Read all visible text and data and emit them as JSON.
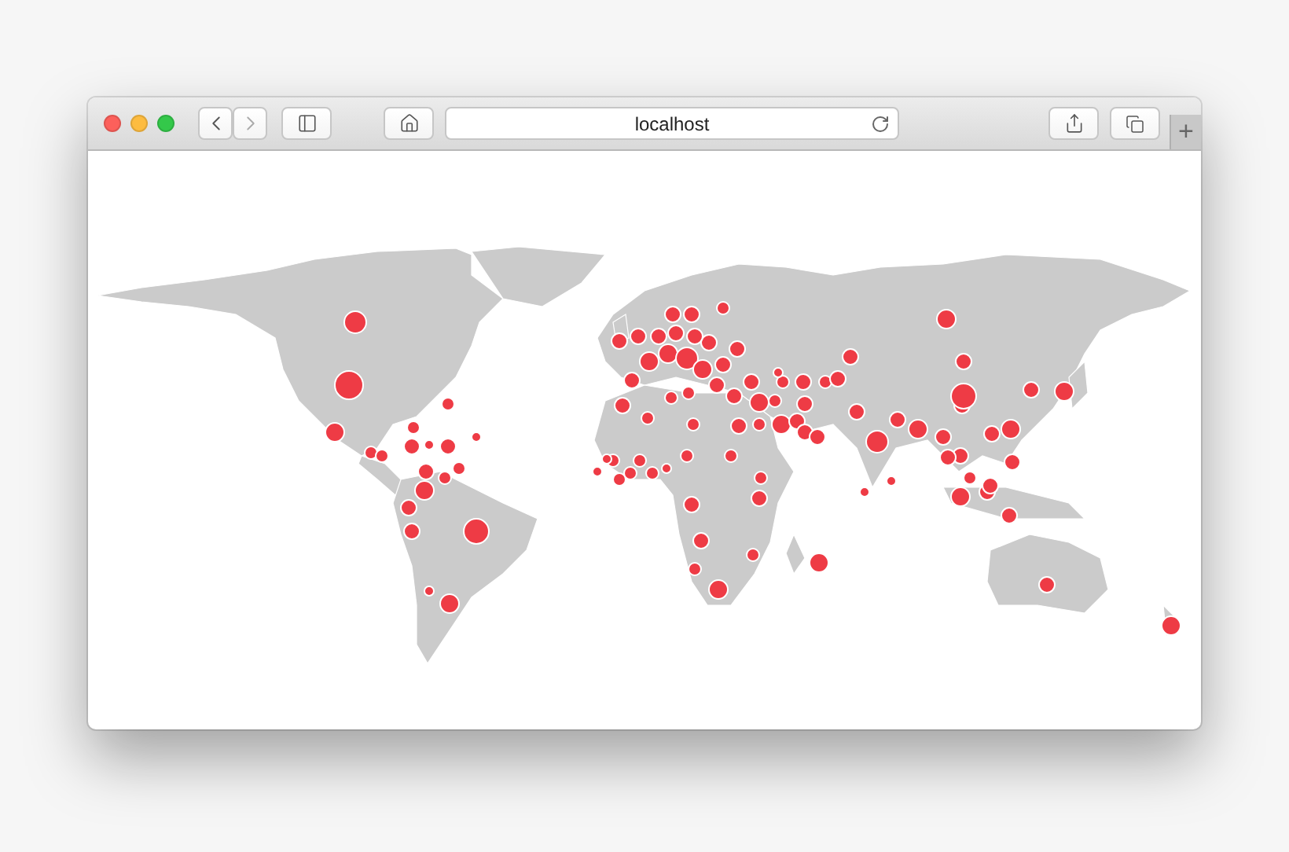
{
  "window": {
    "address": "localhost",
    "new_tab": "+"
  }
}
